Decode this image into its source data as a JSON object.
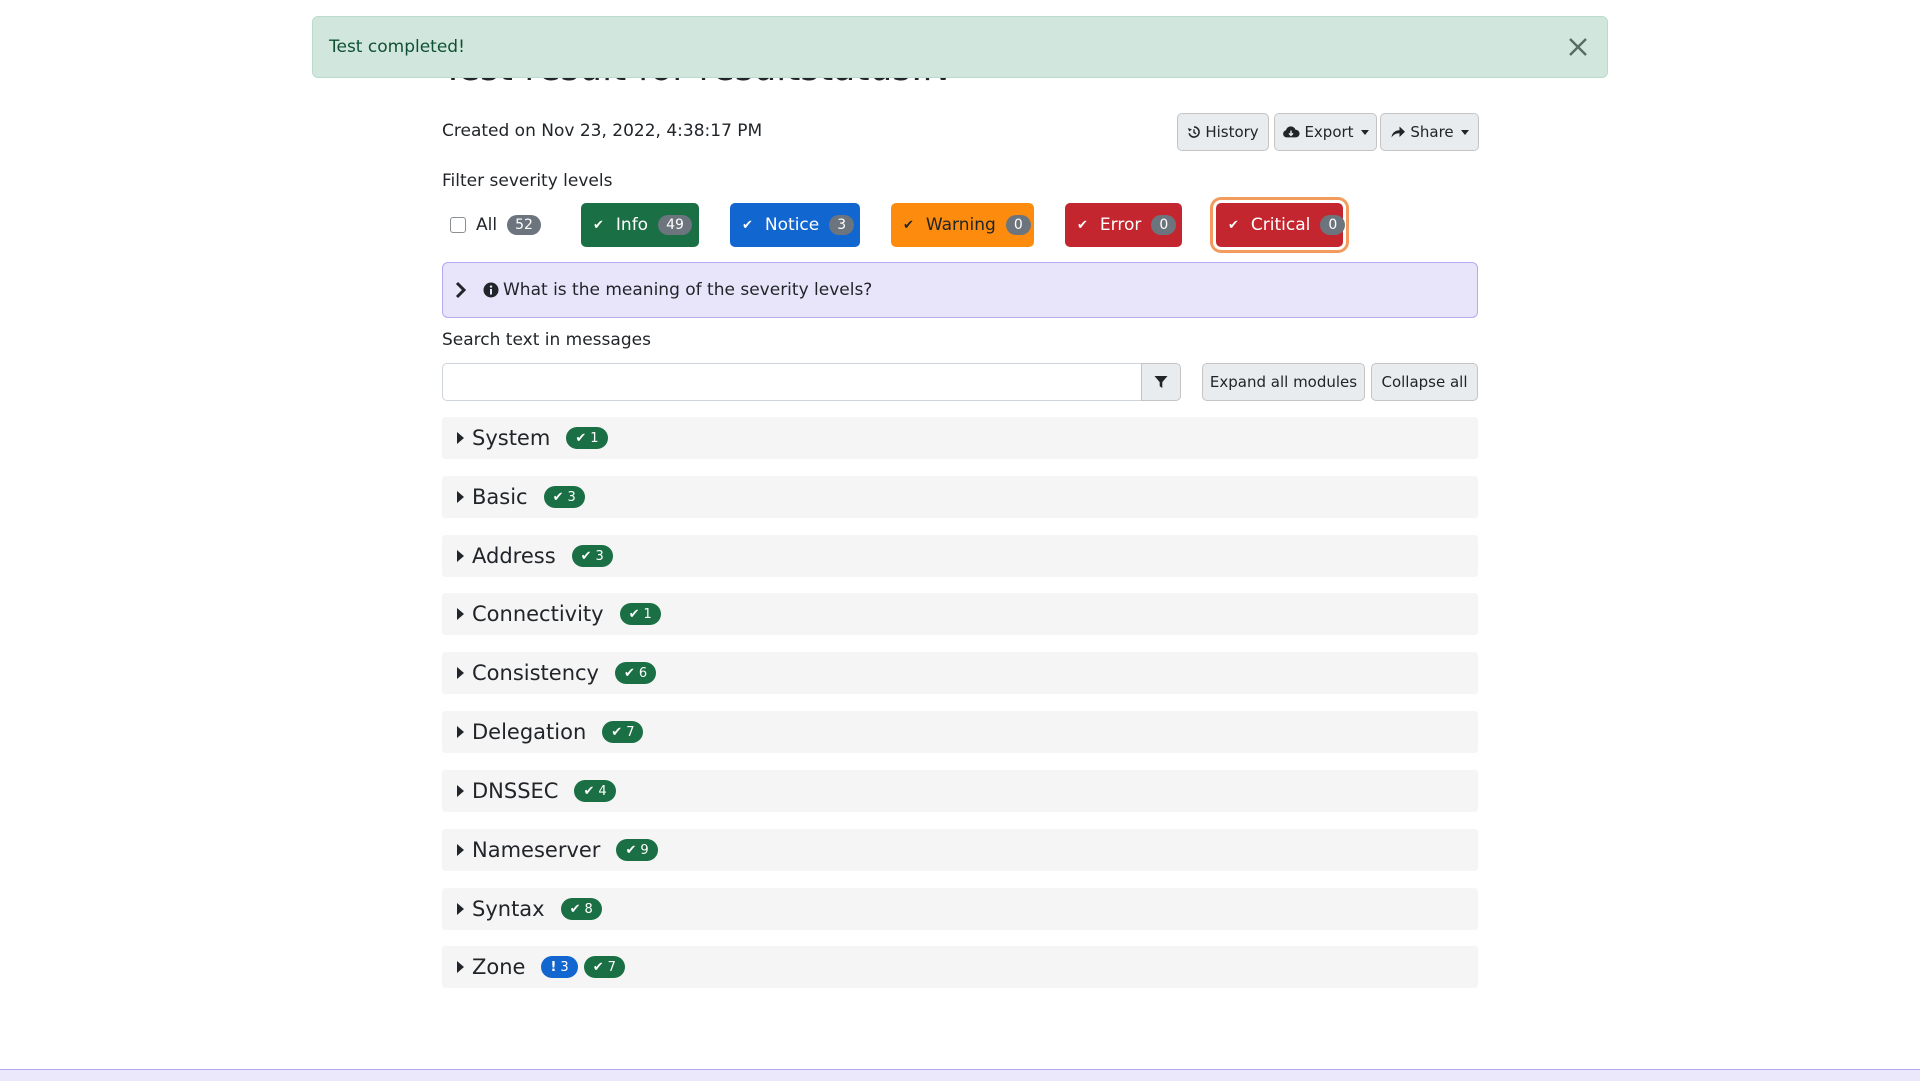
{
  "alert": {
    "text": "Test completed!",
    "close_icon": "close-icon"
  },
  "page": {
    "title": "Test result for resultstatus.lv",
    "created": "Created on Nov 23, 2022, 4:38:17 PM"
  },
  "toolbar": {
    "history": "History",
    "export": "Export",
    "share": "Share"
  },
  "filter": {
    "label": "Filter severity levels",
    "all": {
      "label": "All",
      "count": "52"
    },
    "levels": [
      {
        "label": "Info",
        "count": "49",
        "color": "#1a7044"
      },
      {
        "label": "Notice",
        "count": "3",
        "color": "#1266cf"
      },
      {
        "label": "Warning",
        "count": "0",
        "color": "#fd8c0e"
      },
      {
        "label": "Error",
        "count": "0",
        "color": "#c3262f"
      },
      {
        "label": "Critical",
        "count": "0",
        "color": "#c3262f"
      }
    ]
  },
  "severity_info": {
    "text": "What is the meaning of the severity levels?"
  },
  "search": {
    "label": "Search text in messages",
    "placeholder": "",
    "value": ""
  },
  "actions": {
    "expand": "Expand all modules",
    "collapse": "Collapse all"
  },
  "modules": [
    {
      "name": "System",
      "info": "1"
    },
    {
      "name": "Basic",
      "info": "3"
    },
    {
      "name": "Address",
      "info": "3"
    },
    {
      "name": "Connectivity",
      "info": "1"
    },
    {
      "name": "Consistency",
      "info": "6"
    },
    {
      "name": "Delegation",
      "info": "7"
    },
    {
      "name": "DNSSEC",
      "info": "4"
    },
    {
      "name": "Nameserver",
      "info": "9"
    },
    {
      "name": "Syntax",
      "info": "8"
    },
    {
      "name": "Zone",
      "notice": "3",
      "info": "7"
    }
  ],
  "colors": {
    "info": "#1a7044",
    "notice": "#1266cf",
    "alert_bg": "#d1e7dd"
  }
}
